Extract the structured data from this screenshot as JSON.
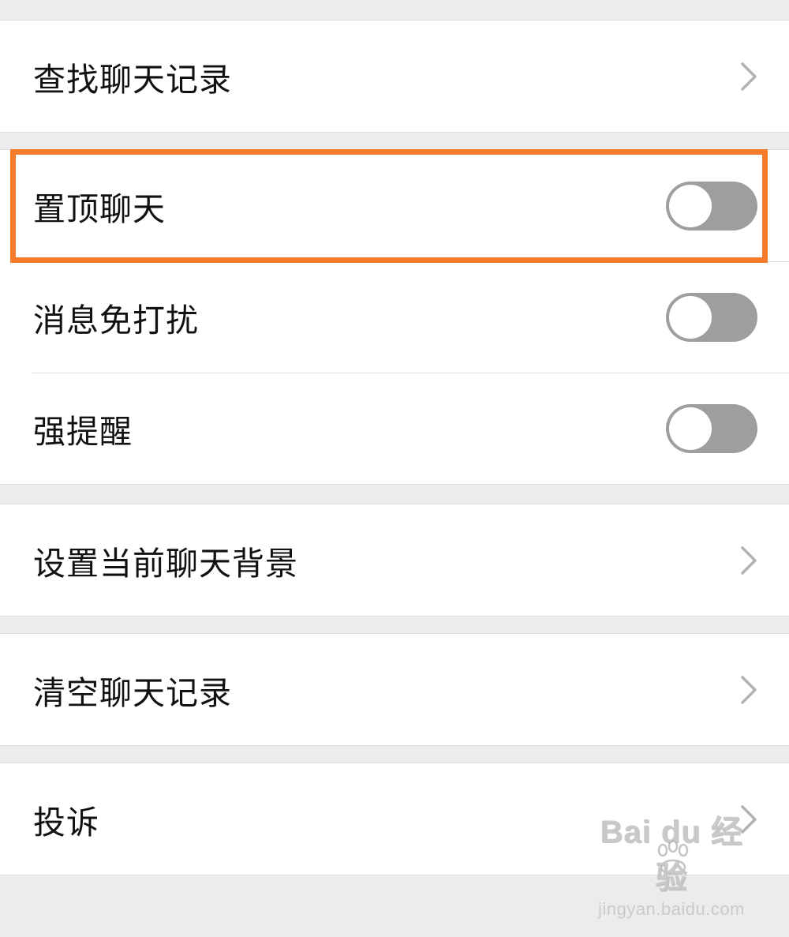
{
  "settings": {
    "search_history": "查找聊天记录",
    "pin_chat": "置顶聊天",
    "mute_notifications": "消息免打扰",
    "strong_reminder": "强提醒",
    "set_background": "设置当前聊天背景",
    "clear_history": "清空聊天记录",
    "report": "投诉"
  },
  "toggles": {
    "pin_chat": false,
    "mute_notifications": false,
    "strong_reminder": false
  },
  "icons": {
    "chevron": "chevron-right-icon",
    "toggle": "switch-off-icon"
  },
  "colors": {
    "highlight": "#f57c2c",
    "toggle_off": "#9e9e9e",
    "background": "#ececec"
  },
  "watermark": {
    "main": "Bai du 经验",
    "sub": "jingyan.baidu.com"
  }
}
